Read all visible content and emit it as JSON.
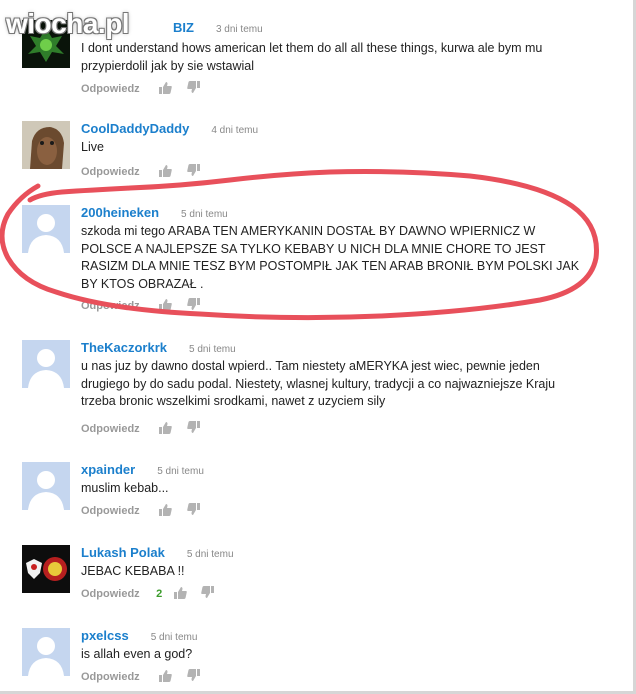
{
  "watermark": "wiocha.pl",
  "colors": {
    "author": "#1b7fcc",
    "highlight_loop": "#e8505b",
    "likes_positive": "#3c9c2c"
  },
  "comments": [
    {
      "author": "BIZ",
      "time": "3 dni temu",
      "text": "I dont understand hows american let them do all all these things, kurwa ale bym mu przypierdolil jak by sie wstawial",
      "reply": "Odpowiedz",
      "likes": ""
    },
    {
      "author": "CoolDaddyDaddy",
      "time": "4 dni temu",
      "text": "Live",
      "reply": "Odpowiedz",
      "likes": ""
    },
    {
      "author": "200heineken",
      "time": "5 dni temu",
      "text": "szkoda mi tego ARABA TEN AMERYKANIN DOSTAŁ BY DAWNO WPIERNICZ W POLSCE A NAJLEPSZE SA TYLKO KEBABY U NICH DLA MNIE CHORE TO JEST RASIZM DLA MNIE TESZ BYM POSTOMPIŁ JAK TEN ARAB BRONIŁ BYM POLSKI JAK BY KTOS OBRAZAŁ .",
      "reply": "Odpowiedz",
      "likes": ""
    },
    {
      "author": "TheKaczorkrk",
      "time": "5 dni temu",
      "text": "u nas juz by dawno dostal wpierd.. Tam niestety aMERYKA jest wiec, pewnie jeden drugiego by do sadu podal. Niestety, wlasnej kultury, tradycji a co najwazniejsze Kraju trzeba bronic wszelkimi srodkami, nawet z uzyciem sily",
      "reply": "Odpowiedz",
      "likes": ""
    },
    {
      "author": "xpainder",
      "time": "5 dni temu",
      "text": "muslim kebab...",
      "reply": "Odpowiedz",
      "likes": ""
    },
    {
      "author": "Lukash Polak",
      "time": "5 dni temu",
      "text": "JEBAC KEBABA !!",
      "reply": "Odpowiedz",
      "likes": "2"
    },
    {
      "author": "pxelcss",
      "time": "5 dni temu",
      "text": "is allah even a god?",
      "reply": "Odpowiedz",
      "likes": ""
    }
  ],
  "icons": {
    "like": "thumbs-up-icon",
    "dislike": "thumbs-down-icon"
  }
}
